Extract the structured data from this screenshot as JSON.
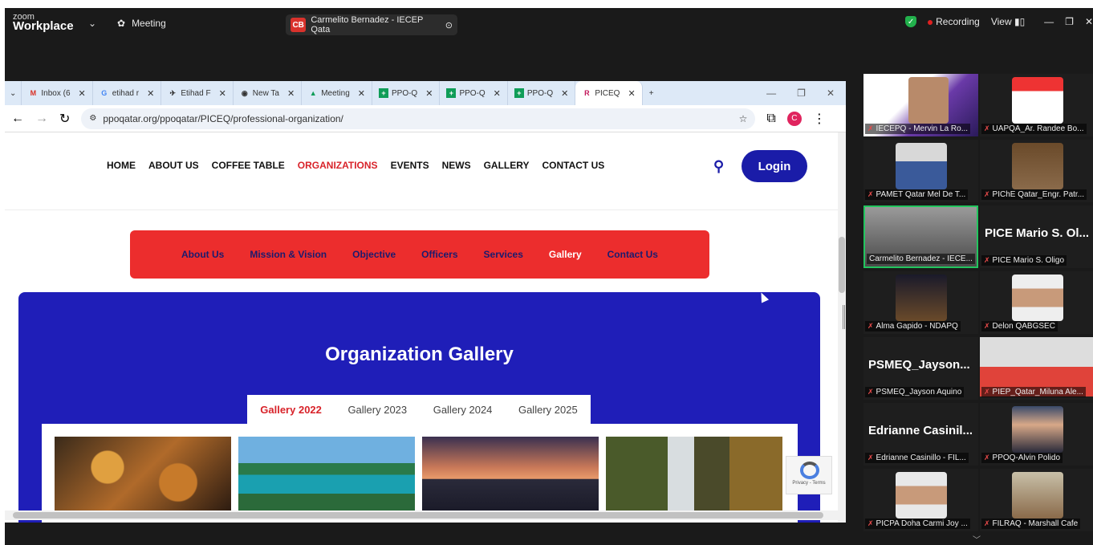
{
  "zoom": {
    "logo_top": "zoom",
    "logo_bottom": "Workplace",
    "meeting_label": "Meeting",
    "share_initials": "CB",
    "share_title": "Carmelito Bernadez - IECEP Qata",
    "recording_label": "Recording",
    "view_label": "View"
  },
  "browser": {
    "tabs": [
      {
        "icon": "M",
        "label": "Inbox (6"
      },
      {
        "icon": "G",
        "label": "etihad r"
      },
      {
        "icon": "✈",
        "label": "Etihad F"
      },
      {
        "icon": "◉",
        "label": "New Ta"
      },
      {
        "icon": "▲",
        "label": "Meeting"
      },
      {
        "icon": "+",
        "label": "PPO-Q"
      },
      {
        "icon": "+",
        "label": "PPO-Q"
      },
      {
        "icon": "+",
        "label": "PPO-Q"
      },
      {
        "icon": "R",
        "label": "PICEQ"
      }
    ],
    "url": "ppoqatar.org/ppoqatar/PICEQ/professional-organization/",
    "profile_initial": "C"
  },
  "site": {
    "nav": [
      "HOME",
      "ABOUT US",
      "COFFEE TABLE",
      "ORGANIZATIONS",
      "EVENTS",
      "NEWS",
      "GALLERY",
      "CONTACT US"
    ],
    "login": "Login",
    "subnav": [
      "About Us",
      "Mission & Vision",
      "Objective",
      "Officers",
      "Services",
      "Gallery",
      "Contact Us"
    ],
    "gallery_title": "Organization Gallery",
    "gallery_tabs": [
      "Gallery 2022",
      "Gallery 2023",
      "Gallery 2024",
      "Gallery 2025"
    ],
    "recaptcha": "Privacy - Terms"
  },
  "participants": [
    {
      "label": "IECEPQ - Mervin La Ro..."
    },
    {
      "label": "UAPQA_Ar. Randee Bo..."
    },
    {
      "label": "PAMET Qatar Mel De T..."
    },
    {
      "label": "PIChE Qatar_Engr. Patr..."
    },
    {
      "label": "Carmelito Bernadez - IECE..."
    },
    {
      "label": "PICE Mario S. Oligo",
      "big": "PICE Mario S. Ol..."
    },
    {
      "label": "Alma Gapido - NDAPQ"
    },
    {
      "label": "Delon QABGSEC"
    },
    {
      "label": "PSMEQ_Jayson Aquino",
      "big": "PSMEQ_Jayson..."
    },
    {
      "label": "PIEP_Qatar_Miluna Ale..."
    },
    {
      "label": "Edrianne Casinillo - FIL...",
      "big": "Edrianne Casinil..."
    },
    {
      "label": "PPOQ-Alvin Polido"
    },
    {
      "label": "PICPA Doha Carmi Joy ..."
    },
    {
      "label": "FILRAQ - Marshall Cafe"
    }
  ],
  "colors": {
    "brand_blue": "#1f1eb8",
    "brand_red": "#ec2d2d",
    "active_speaker": "#22c55e"
  }
}
